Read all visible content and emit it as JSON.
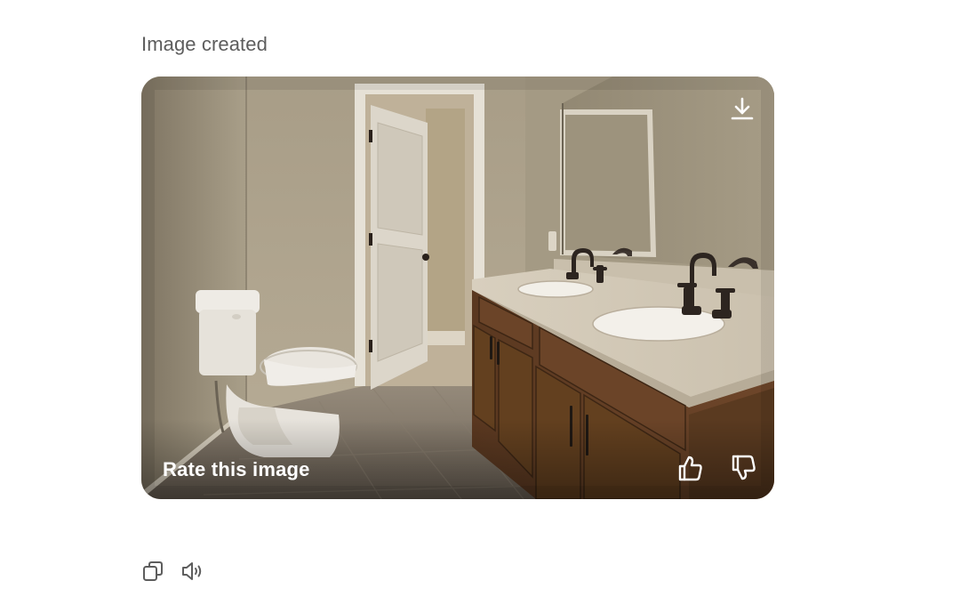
{
  "message": {
    "status_text": "Image created"
  },
  "image": {
    "rate_label": "Rate this image",
    "icons": {
      "download": "download-icon",
      "thumbs_up": "thumbs-up-icon",
      "thumbs_down": "thumbs-down-icon"
    }
  },
  "actions": {
    "icons": [
      "copy-icon",
      "read-aloud-icon"
    ]
  },
  "colors": {
    "status_text": "#5d5d5d",
    "overlay_text": "#ffffff",
    "action_icon": "#5d5d5d"
  }
}
